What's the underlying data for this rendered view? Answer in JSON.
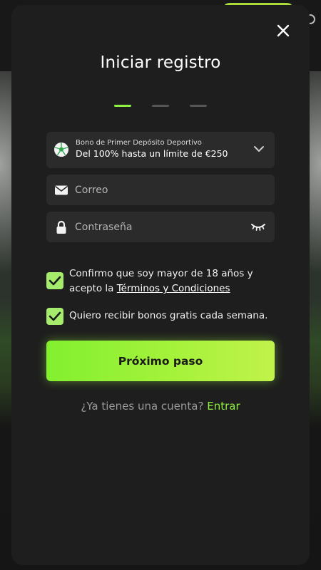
{
  "modal": {
    "title": "Iniciar registro",
    "steps_total": 3,
    "current_step": 1
  },
  "bonus": {
    "label": "Bono de Primer Depósito Deportivo",
    "value": "Del 100% hasta un límite de €250",
    "icon": "soccer-ball-icon"
  },
  "form": {
    "email_placeholder": "Correo",
    "password_placeholder": "Contraseña"
  },
  "checks": {
    "age_text": "Confirmo que soy mayor de 18 años y acepto la ",
    "terms_link": "Términos y Condiciones",
    "bonus_text": "Quiero recibir bonos gratis cada semana.",
    "age_checked": true,
    "bonus_checked": true
  },
  "buttons": {
    "next_label": "Próximo paso"
  },
  "footer": {
    "question": "¿Ya tienes una cuenta?",
    "login_link": "Entrar"
  },
  "colors": {
    "accent": "#8ef03f",
    "modal_bg": "#1e1e1e",
    "field_bg": "#2b2b2b"
  }
}
